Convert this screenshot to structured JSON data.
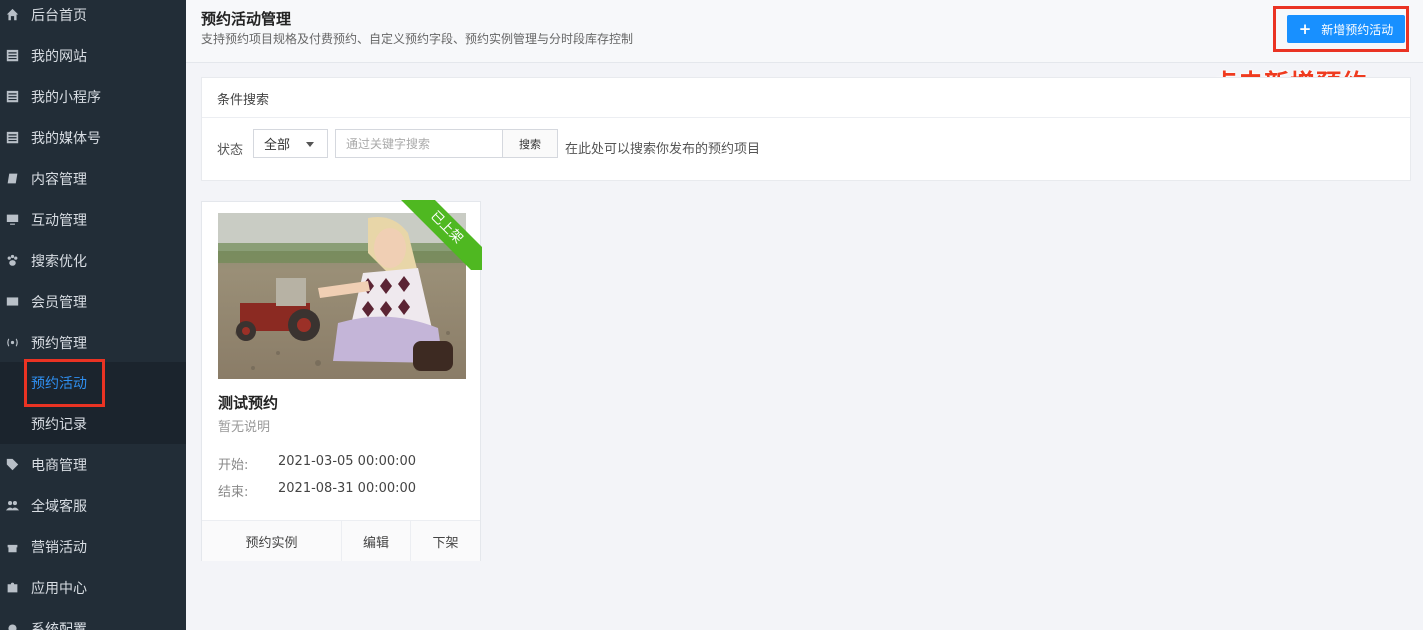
{
  "sidebar": {
    "items": [
      {
        "label": "后台首页",
        "icon": "home-icon"
      },
      {
        "label": "我的网站",
        "icon": "list-icon"
      },
      {
        "label": "我的小程序",
        "icon": "list-icon"
      },
      {
        "label": "我的媒体号",
        "icon": "list-icon"
      },
      {
        "label": "内容管理",
        "icon": "book-icon"
      },
      {
        "label": "互动管理",
        "icon": "monitor-icon"
      },
      {
        "label": "搜索优化",
        "icon": "paw-icon"
      },
      {
        "label": "会员管理",
        "icon": "id-card-icon"
      },
      {
        "label": "预约管理",
        "icon": "broadcast-icon"
      },
      {
        "label": "电商管理",
        "icon": "tags-icon"
      },
      {
        "label": "全域客服",
        "icon": "users-icon"
      },
      {
        "label": "营销活动",
        "icon": "gift-icon"
      },
      {
        "label": "应用中心",
        "icon": "puzzle-icon"
      },
      {
        "label": "系统配置",
        "icon": "gear-icon"
      }
    ],
    "submenu": [
      {
        "label": "预约活动",
        "active": true
      },
      {
        "label": "预约记录",
        "active": false
      }
    ],
    "active_color": "#2f8ff0"
  },
  "header": {
    "title": "预约活动管理",
    "subtitle": "支持预约项目规格及付费预约、自定义预约字段、预约实例管理与分时段库存控制",
    "add_button_icon": "+",
    "add_button_label": "新增预约活动"
  },
  "annotation": "点击新增预约",
  "search_panel": {
    "title": "条件搜索",
    "status_label": "状态",
    "status_value": "全部",
    "search_placeholder": "通过关键字搜索",
    "search_button": "搜索",
    "hint": "在此处可以搜索你发布的预约项目"
  },
  "cards": [
    {
      "ribbon": "已上架",
      "title": "测试预约",
      "description": "暂无说明",
      "start_label": "开始:",
      "start_value": "2021-03-05 00:00:00",
      "end_label": "结束:",
      "end_value": "2021-08-31 00:00:00",
      "actions": [
        "预约实例",
        "编辑",
        "下架"
      ]
    }
  ],
  "colors": {
    "sidebar_bg": "#222d37",
    "primary": "#1890ff",
    "ribbon": "#4fb821",
    "highlight": "#ea3323"
  }
}
